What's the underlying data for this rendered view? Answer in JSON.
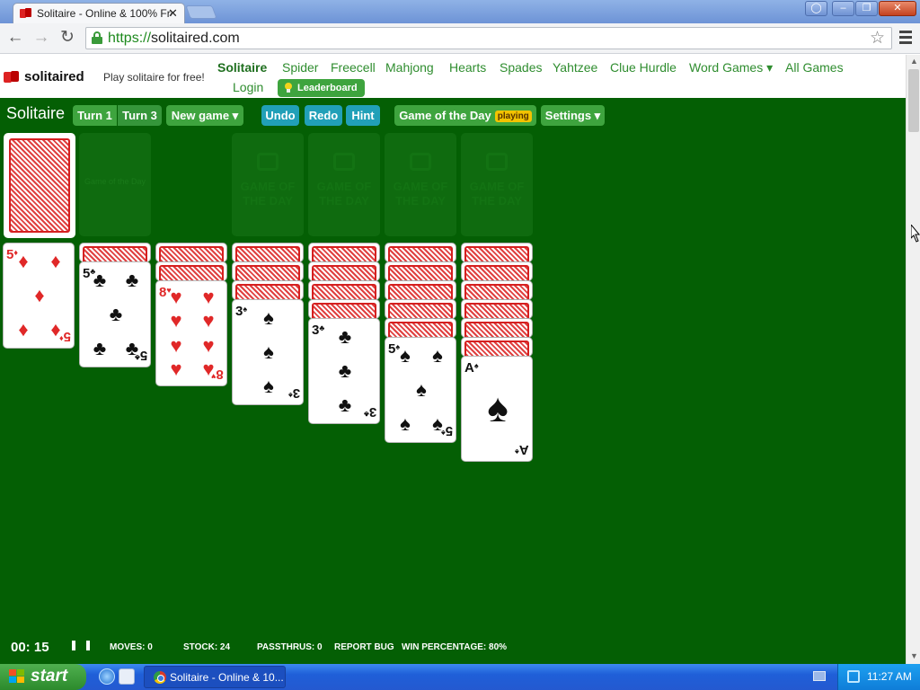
{
  "browser": {
    "tab_title": "Solitaire - Online & 100% Fre",
    "tab_close": "✕",
    "url_scheme": "https://",
    "url_host": "solitaired.com",
    "window_buttons": [
      "◯",
      "–",
      "❐",
      "✕"
    ]
  },
  "site": {
    "logo_text": "solitaired",
    "tagline": "Play solitaire for free!",
    "nav": [
      "Solitaire",
      "Spider",
      "Freecell",
      "Mahjong",
      "Hearts",
      "Spades",
      "Yahtzee",
      "Clue Hurdle",
      "Word Games ▾",
      "All Games"
    ],
    "login": "Login",
    "leaderboard": "Leaderboard"
  },
  "game": {
    "name": "Solitaire",
    "buttons": {
      "turn1": "Turn 1",
      "turn3": "Turn 3",
      "new_game": "New game ▾",
      "undo": "Undo",
      "redo": "Redo",
      "hint": "Hint",
      "game_of_day": "Game of the Day",
      "playing": "playing",
      "settings": "Settings ▾"
    },
    "foundation_watermark": "GAME OF THE DAY",
    "waste_watermark": "Game of the Day",
    "tableau": [
      {
        "hidden": 0,
        "face": {
          "rank": "5",
          "suit": "♦",
          "color": "red"
        }
      },
      {
        "hidden": 1,
        "face": {
          "rank": "5",
          "suit": "♣",
          "color": "black"
        }
      },
      {
        "hidden": 2,
        "face": {
          "rank": "8",
          "suit": "♥",
          "color": "red"
        }
      },
      {
        "hidden": 3,
        "face": {
          "rank": "3",
          "suit": "♠",
          "color": "black"
        }
      },
      {
        "hidden": 4,
        "face": {
          "rank": "3",
          "suit": "♣",
          "color": "black"
        }
      },
      {
        "hidden": 5,
        "face": {
          "rank": "5",
          "suit": "♠",
          "color": "black"
        }
      },
      {
        "hidden": 6,
        "face": {
          "rank": "A",
          "suit": "♠",
          "color": "black"
        }
      }
    ]
  },
  "status": {
    "timer": "00: 15",
    "moves": "MOVES: 0",
    "stock": "STOCK: 24",
    "passthrus": "PASSTHRUS: 0",
    "report_bug": "REPORT BUG",
    "win_pct": "WIN PERCENTAGE: 80%"
  },
  "taskbar": {
    "start": "start",
    "task_label": "Solitaire - Online & 10...",
    "clock": "11:27 AM"
  },
  "colors": {
    "felt": "#045f04",
    "green_button": "#3ea43e",
    "teal_button": "#21a0b8",
    "card_red": "#e02828"
  }
}
